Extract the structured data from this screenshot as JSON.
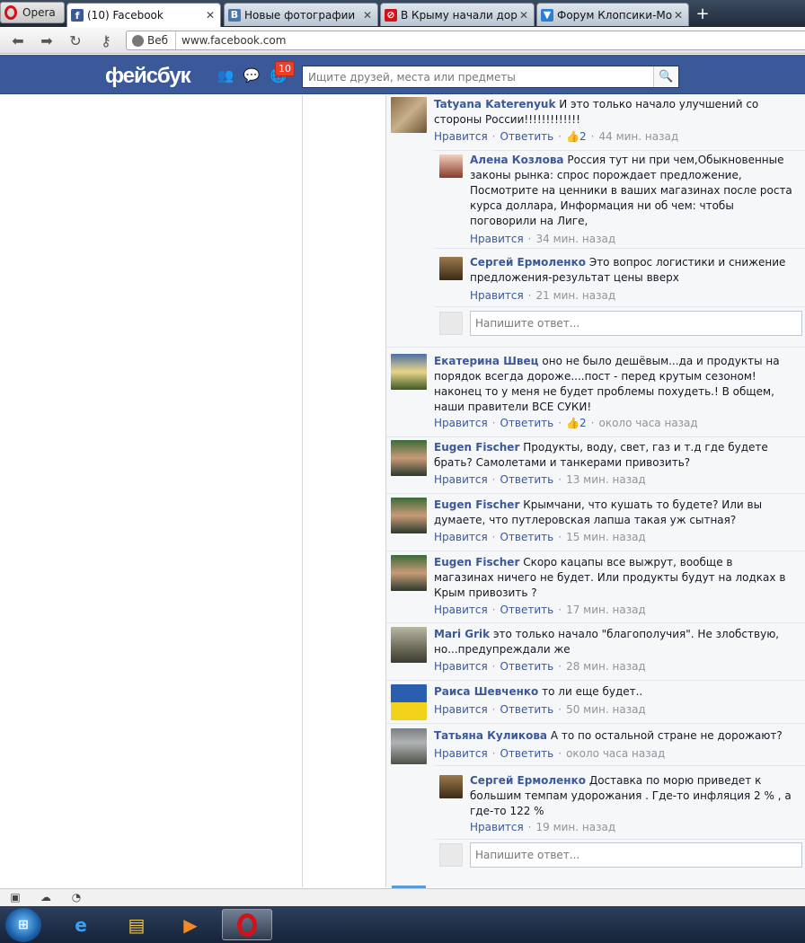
{
  "browser": {
    "menu_label": "Opera",
    "tabs": [
      {
        "label": "(10) Facebook",
        "icon": "facebook-icon",
        "color": "#3b5998"
      },
      {
        "label": "Новые фотографии",
        "icon": "vk-icon",
        "color": "#4a76a8"
      },
      {
        "label": "В Крыму начали доро",
        "icon": "news-icon",
        "color": "#d0121b"
      },
      {
        "label": "Форум Клопсики-Мо",
        "icon": "forum-icon",
        "color": "#2a7fd4"
      }
    ],
    "new_tab": "+",
    "address_prefix": "Веб",
    "url": "www.facebook.com"
  },
  "header": {
    "logo": "фейсбук",
    "notifications_count": "10",
    "search_placeholder": "Ищите друзей, места или предметы"
  },
  "comments": [
    {
      "name": "Tatyana Katerenyuk",
      "text": "И это только начало улучшений со стороны России!!!!!!!!!!!!!",
      "like": "Нравится",
      "reply": "Ответить",
      "likes": "2",
      "time": "44 мин. назад",
      "replies": [
        {
          "name": "Алена Козлова",
          "text": "Россия тут ни при чем,Обыкновенные законы рынка: спрос порождает предложение, Посмотрите на ценники в ваших магазинах после роста курса доллара, Информация ни об чем: чтобы поговорили на Лиге,",
          "like": "Нравится",
          "time": "34 мин. назад"
        },
        {
          "name": "Сергей Ермоленко",
          "text": "Это вопрос логистики и снижение предложения-результат цены вверх",
          "like": "Нравится",
          "time": "21 мин. назад"
        }
      ],
      "reply_placeholder": "Напишите ответ..."
    },
    {
      "name": "Екатерина Швец",
      "text": "оно не было дешёвым...да и продукты на порядок всегда дороже....пост - перед крутым сезоном! наконец то у меня не будет проблемы похудеть.! В общем, наши правители ВСЕ СУКИ!",
      "like": "Нравится",
      "reply": "Ответить",
      "likes": "2",
      "time": "около часа назад"
    },
    {
      "name": "Eugen Fischer",
      "text": "Продукты, воду, свет, газ и т.д где будете брать? Самолетами и танкерами привозить?",
      "like": "Нравится",
      "reply": "Ответить",
      "time": "13 мин. назад"
    },
    {
      "name": "Eugen Fischer",
      "text": "Крымчани, что кушать то будете? Или вы думаете, что путлеровская лапша такая уж сытная?",
      "like": "Нравится",
      "reply": "Ответить",
      "time": "15 мин. назад"
    },
    {
      "name": "Eugen Fischer",
      "text": "Скоро кацапы все выжрут, вообще в магазинах ничего не будет. Или продукты будут на лодках в Крым привозить ?",
      "like": "Нравится",
      "reply": "Ответить",
      "time": "17 мин. назад"
    },
    {
      "name": "Mari Grik",
      "text": "это только начало \"благополучия\". Не злобствую, но...предупреждали же",
      "like": "Нравится",
      "reply": "Ответить",
      "time": "28 мин. назад"
    },
    {
      "name": "Раиса Шевченко",
      "text": "то ли еще будет..",
      "like": "Нравится",
      "reply": "Ответить",
      "time": "50 мин. назад"
    },
    {
      "name": "Татьяна Куликова",
      "text": "А то по остальной стране не дорожают?",
      "like": "Нравится",
      "reply": "Ответить",
      "time": "около часа назад",
      "replies": [
        {
          "name": "Сергей Ермоленко",
          "text": "Доставка по морю приведет к большим темпам удорожания . Где-то инфляция 2 % , а где-то 122 %",
          "like": "Нравится",
          "time": "19 мин. назад"
        }
      ],
      "reply_placeholder": "Напишите ответ..."
    }
  ]
}
